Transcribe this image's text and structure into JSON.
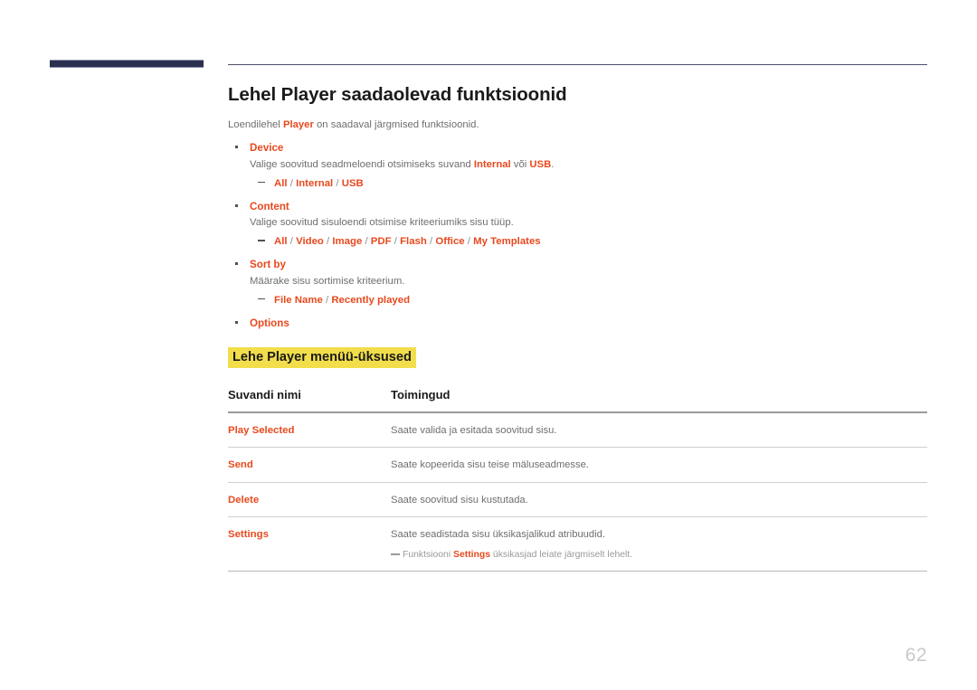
{
  "colors": {
    "accent_orange": "#e8491e",
    "navy_bar": "#2b3050",
    "highlight_yellow": "#f2de4b",
    "body_gray": "#6e6e6e",
    "page_number_gray": "#c9c9c9"
  },
  "title": "Lehel Player saadaolevad funktsioonid",
  "intro": {
    "before": "Loendilehel ",
    "keyword": "Player",
    "after": " on saadaval järgmised funktsioonid."
  },
  "features": [
    {
      "name": "Device",
      "description_before": "Valige soovitud seadmeloendi otsimiseks suvand ",
      "description_kw1": "Internal",
      "description_mid": " või ",
      "description_kw2": "USB",
      "description_after": ".",
      "options": [
        "All",
        "Internal",
        "USB"
      ]
    },
    {
      "name": "Content",
      "description_before": "Valige soovitud sisuloendi otsimise kriteeriumiks sisu tüüp.",
      "description_kw1": "",
      "description_mid": "",
      "description_kw2": "",
      "description_after": "",
      "options": [
        "All",
        "Video",
        "Image",
        "PDF",
        "Flash",
        "Office",
        "My Templates"
      ]
    },
    {
      "name": "Sort by",
      "description_before": "Määrake sisu sortimise kriteerium.",
      "description_kw1": "",
      "description_mid": "",
      "description_kw2": "",
      "description_after": "",
      "options": [
        "File Name",
        "Recently played"
      ]
    },
    {
      "name": "Options",
      "description_before": "",
      "description_kw1": "",
      "description_mid": "",
      "description_kw2": "",
      "description_after": "",
      "options": []
    }
  ],
  "sub_heading": "Lehe Player menüü-üksused",
  "table": {
    "headers": [
      "Suvandi nimi",
      "Toimingud"
    ],
    "rows": [
      {
        "name": "Play Selected",
        "description": "Saate valida ja esitada soovitud sisu.",
        "note": null
      },
      {
        "name": "Send",
        "description": "Saate kopeerida sisu teise mäluseadmesse.",
        "note": null
      },
      {
        "name": "Delete",
        "description": "Saate soovitud sisu kustutada.",
        "note": null
      },
      {
        "name": "Settings",
        "description": "Saate seadistada sisu üksikasjalikud atribuudid.",
        "note": {
          "before": "Funktsiooni ",
          "keyword": "Settings",
          "after": " üksikasjad leiate järgmiselt lehelt."
        }
      }
    ]
  },
  "page_number": "62"
}
